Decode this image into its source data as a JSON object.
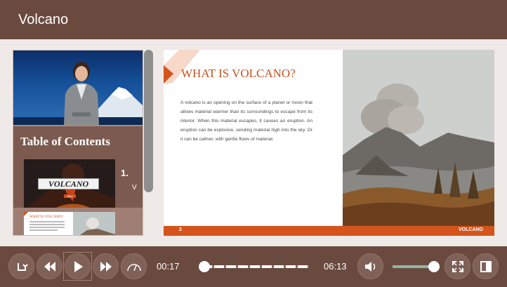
{
  "header": {
    "title": "Volcano"
  },
  "sidebar": {
    "toc_title": "Table of Contents",
    "items": [
      {
        "number": "1.",
        "more": "V",
        "thumb_title": "VOLCANO",
        "thumb_button": "Start"
      },
      {
        "thumb_title": "WHAT IS VOLCANO?"
      }
    ]
  },
  "slide": {
    "heading": "WHAT IS VOLCANO?",
    "body": "A volcano is an opening on the surface of a planet or moon that allows material warmer than its surroundings to escape from its interior. When this material escapes, it causes an eruption. An eruption can be explosive, sending material high into the sky. Or it can be calmer, with gentle flows of material.",
    "number": "2",
    "footer_title": "VOLCANO"
  },
  "player": {
    "current_time": "00:17",
    "total_time": "06:13",
    "progress": 0.02,
    "volume": 0.85
  },
  "icons": {
    "replay": "replay-icon",
    "rewind": "rewind-icon",
    "play": "play-icon",
    "forward": "fast-forward-icon",
    "speed": "speedometer-icon",
    "volume": "volume-icon",
    "fullscreen": "fullscreen-icon",
    "sidebar": "sidebar-toggle-icon"
  },
  "colors": {
    "brand": "#6a4a3f",
    "accent": "#d4541c",
    "volume": "#8fb5a7"
  }
}
